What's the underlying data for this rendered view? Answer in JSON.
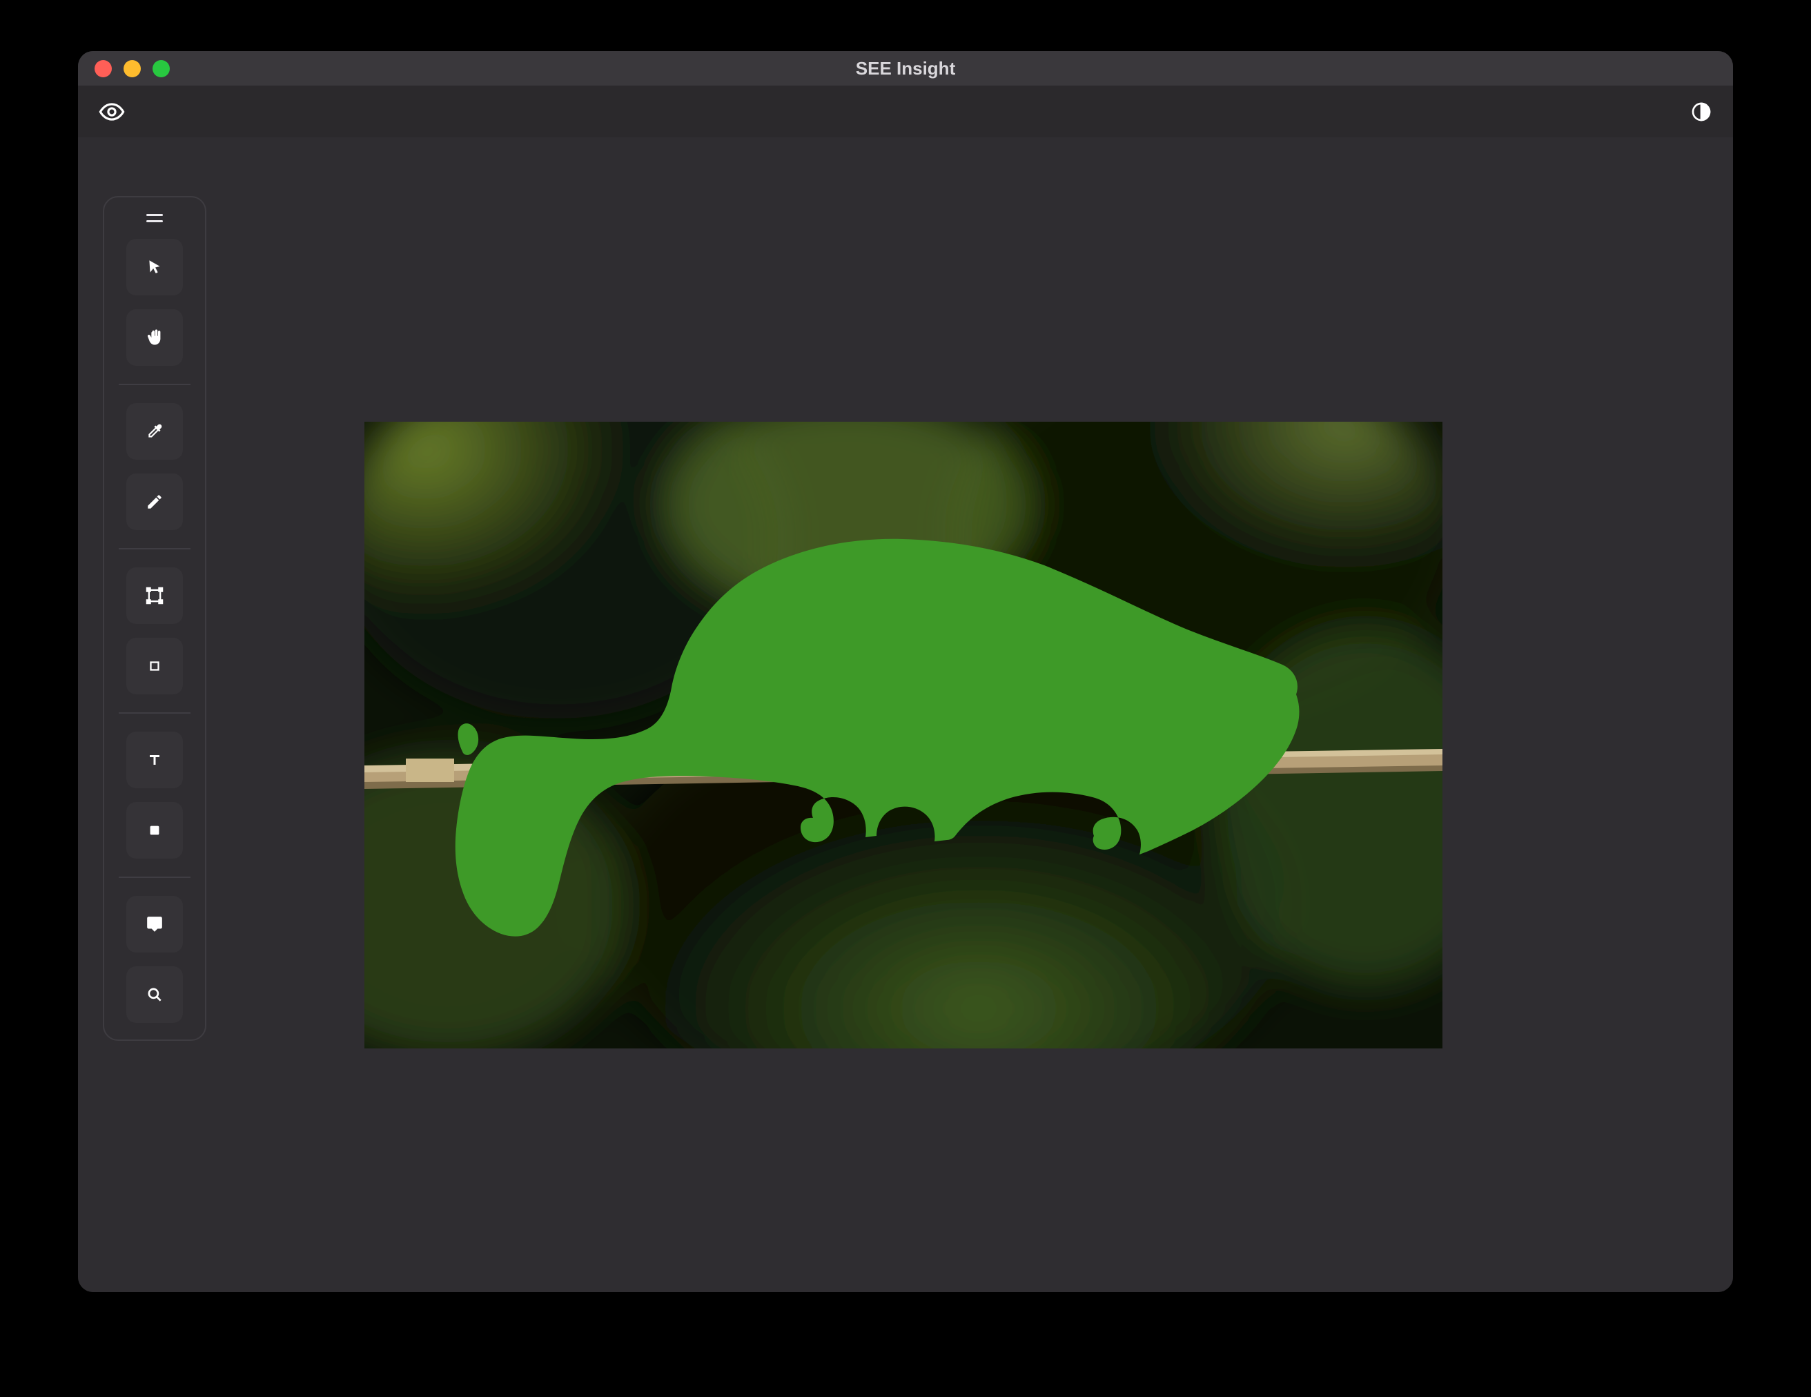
{
  "window": {
    "title": "SEE Insight"
  },
  "toolbar": {
    "left_icon": "eye-icon",
    "right_icon": "contrast-icon"
  },
  "tools": {
    "groups": [
      [
        {
          "name": "cursor-tool",
          "icon": "cursor-icon"
        },
        {
          "name": "pan-tool",
          "icon": "hand-icon"
        }
      ],
      [
        {
          "name": "eyedropper-tool",
          "icon": "eyedropper-icon"
        },
        {
          "name": "pencil-tool",
          "icon": "pencil-icon"
        }
      ],
      [
        {
          "name": "bounding-box-tool",
          "icon": "bounding-box-icon"
        },
        {
          "name": "rectangle-tool",
          "icon": "rectangle-outline-icon"
        }
      ],
      [
        {
          "name": "text-tool",
          "icon": "text-icon"
        },
        {
          "name": "stop-tool",
          "icon": "stop-icon"
        }
      ],
      [
        {
          "name": "comment-tool",
          "icon": "comment-icon"
        },
        {
          "name": "search-tool",
          "icon": "search-icon"
        }
      ]
    ]
  },
  "canvas": {
    "subject": "chameleon-segmentation",
    "mask_color": "#3e9a28",
    "branch_color": "#b6a07b"
  }
}
